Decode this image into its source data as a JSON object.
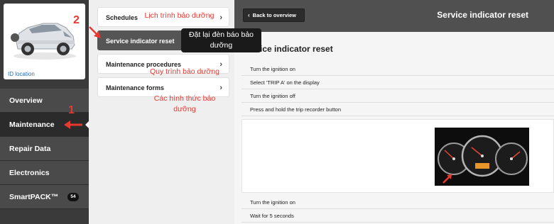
{
  "vehicle": {
    "id_location_label": "ID location"
  },
  "sidebar": {
    "items": [
      {
        "label": "Overview"
      },
      {
        "label": "Maintenance"
      },
      {
        "label": "Repair Data"
      },
      {
        "label": "Electronics"
      },
      {
        "label": "SmartPACK™",
        "badge": "54"
      }
    ]
  },
  "middle": {
    "items": [
      {
        "label": "Schedules"
      },
      {
        "label": "Service indicator reset"
      },
      {
        "label": "Maintenance procedures"
      },
      {
        "label": "Maintenance forms"
      }
    ]
  },
  "content": {
    "back_label": "Back to overview",
    "header_title": "Service indicator reset",
    "section_title": "Service indicator reset",
    "steps": [
      "Turn the ignition on",
      "Select 'TRIP A' on the display",
      "Turn the ignition off",
      "Press and hold the trip recorder button",
      "Turn the ignition on",
      "Wait for 5 seconds"
    ]
  },
  "annotations": {
    "num1": "1",
    "num2": "2",
    "schedules_vi": "Lịch trình bảo dưỡng",
    "reset_vi_line1": "Đặt lại đèn báo bảo",
    "reset_vi_line2": "dưỡng",
    "procedures_vi": "Quy trình bảo dưỡng",
    "forms_vi_line1": "Các hình thức bảo",
    "forms_vi_line2": "dưỡng"
  },
  "colors": {
    "annotation_red": "#e8382f",
    "sidebar_bg": "#3a3a3a",
    "selected_bg": "#555555",
    "link_blue": "#2a6bb5"
  },
  "icons": [
    "car-image",
    "chevron-right-icon",
    "chevron-left-icon",
    "dashboard-gauge-image",
    "annotation-arrow-icon"
  ]
}
